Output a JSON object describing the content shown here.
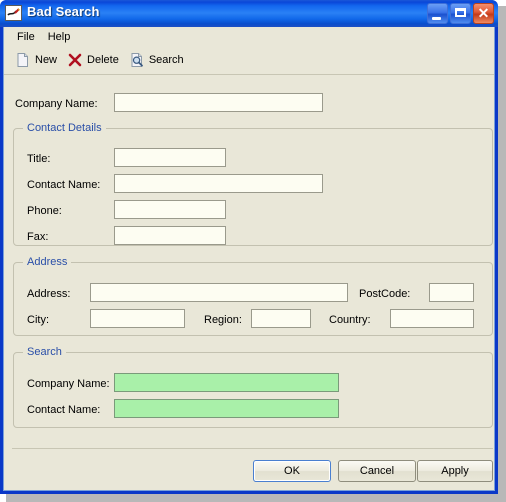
{
  "window": {
    "title": "Bad Search",
    "app_icon": "pen-scribble-icon",
    "buttons": {
      "minimize": "minimize-button",
      "maximize": "maximize-button",
      "close_glyph": "✕"
    }
  },
  "menubar": {
    "items": [
      {
        "label": "File"
      },
      {
        "label": "Help"
      }
    ]
  },
  "toolbar": {
    "items": [
      {
        "label": "New",
        "icon": "new-document-icon"
      },
      {
        "label": "Delete",
        "icon": "red-x-icon"
      },
      {
        "label": "Search",
        "icon": "magnifier-page-icon"
      }
    ]
  },
  "form": {
    "company_name": {
      "label": "Company Name:",
      "value": ""
    },
    "contact_details": {
      "title": "Contact Details",
      "fields": [
        {
          "label": "Title:",
          "value": ""
        },
        {
          "label": "Contact Name:",
          "value": ""
        },
        {
          "label": "Phone:",
          "value": ""
        },
        {
          "label": "Fax:",
          "value": ""
        }
      ]
    },
    "address": {
      "title": "Address",
      "fields": [
        {
          "label": "Address:",
          "value": ""
        },
        {
          "label": "PostCode:",
          "value": ""
        },
        {
          "label": "City:",
          "value": ""
        },
        {
          "label": "Region:",
          "value": ""
        },
        {
          "label": "Country:",
          "value": ""
        }
      ]
    },
    "search": {
      "title": "Search",
      "fields": [
        {
          "label": "Company Name:",
          "value": ""
        },
        {
          "label": "Contact Name:",
          "value": ""
        }
      ]
    }
  },
  "dialog_buttons": {
    "ok": "OK",
    "cancel": "Cancel",
    "apply": "Apply"
  },
  "colors": {
    "titlebar_blue": "#1367ee",
    "window_border": "#0a38c8",
    "form_background": "#e9e7d8",
    "field_background": "#fdfdf2",
    "search_field_green": "#a9f0a9",
    "group_title_blue": "#2a4fa8",
    "delete_icon_red": "#b01020"
  }
}
